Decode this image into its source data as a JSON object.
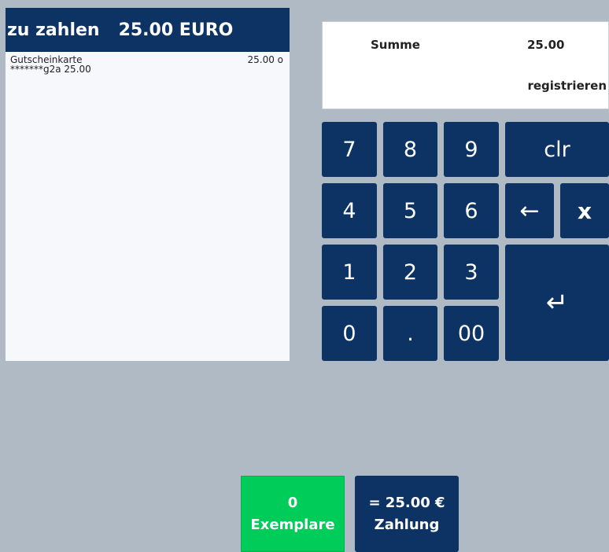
{
  "receipt": {
    "header_label": "zu zahlen",
    "header_amount": "25.00 EURO",
    "lines": [
      {
        "name": "Gutscheinkarte",
        "price": "25.00 o",
        "detail": "*******g2a  25.00"
      }
    ]
  },
  "display": {
    "sum_label": "Summe",
    "sum_value": "25.00",
    "hint": "registrieren"
  },
  "keypad": {
    "k7": "7",
    "k8": "8",
    "k9": "9",
    "clr": "clr",
    "k4": "4",
    "k5": "5",
    "k6": "6",
    "backspace": "←",
    "x": "x",
    "k1": "1",
    "k2": "2",
    "k3": "3",
    "enter": "↵",
    "k0": "0",
    "dot": ".",
    "k00": "00"
  },
  "actions": {
    "copies_count": "0",
    "copies_label": "Exemplare",
    "pay_amount": "= 25.00 €",
    "pay_label": "Zahlung"
  },
  "colors": {
    "navy": "#0c3363",
    "green": "#00cc5a",
    "background": "#b0bac4"
  }
}
